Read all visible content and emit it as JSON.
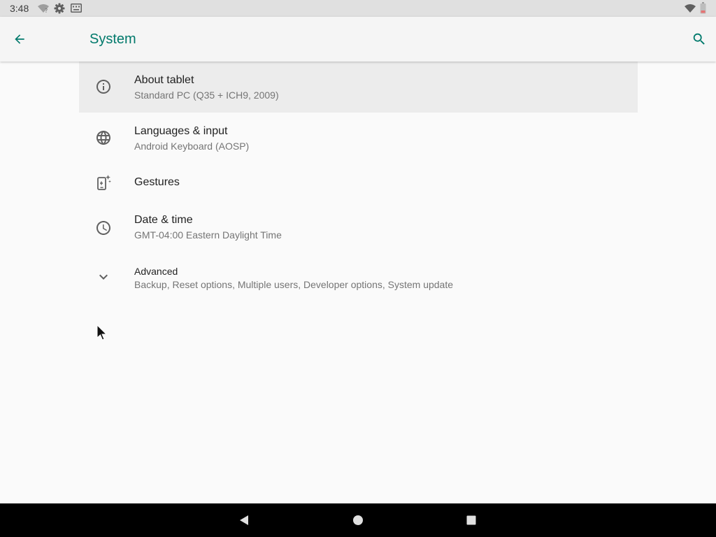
{
  "status_bar": {
    "time": "3:48",
    "icons": [
      "wifi-question-icon",
      "settings-gear-icon",
      "keyboard-icon",
      "wifi-signal-icon",
      "battery-icon"
    ]
  },
  "app_bar": {
    "title": "System",
    "back_icon": "arrow-back-icon",
    "search_icon": "search-icon",
    "accent_color": "#00796b"
  },
  "settings": [
    {
      "title": "About tablet",
      "summary": "Standard PC (Q35 + ICH9, 2009)",
      "icon": "info-icon"
    },
    {
      "title": "Languages & input",
      "summary": "Android Keyboard (AOSP)",
      "icon": "globe-icon"
    },
    {
      "title": "Gestures",
      "icon": "gestures-icon"
    },
    {
      "title": "Date & time",
      "summary": "GMT-04:00 Eastern Daylight Time",
      "icon": "clock-icon"
    },
    {
      "title": "Advanced",
      "summary": "Backup, Reset options, Multiple users, Developer options, System update",
      "icon": "chevron-down-icon"
    }
  ],
  "nav_bar": {
    "icons": [
      "back-triangle-icon",
      "home-circle-icon",
      "recents-square-icon"
    ]
  }
}
